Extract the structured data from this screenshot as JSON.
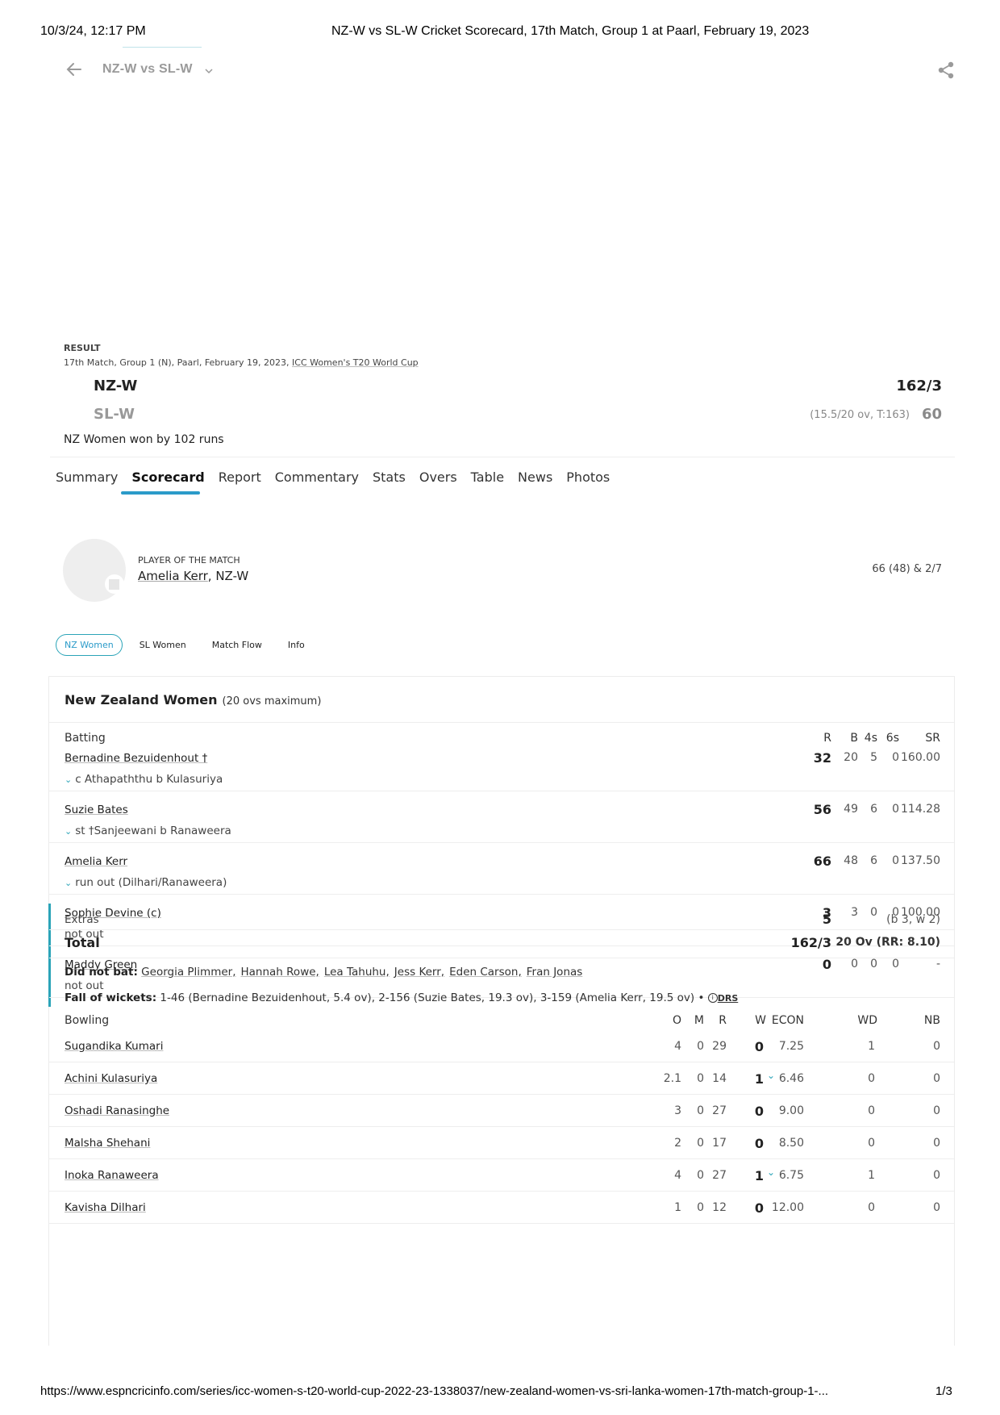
{
  "print_header": {
    "datetime": "10/3/24, 12:17 PM",
    "doc_title": "NZ-W vs SL-W Cricket Scorecard, 17th Match, Group 1 at Paarl, February 19, 2023"
  },
  "topbar": {
    "title": "NZ-W vs SL-W",
    "back_icon": "arrow-left-icon",
    "dropdown_icon": "chevron-down-icon",
    "share_icon": "share-icon"
  },
  "match": {
    "status_label": "RESULT",
    "info": "17th Match, Group 1 (N), Paarl, February 19, 2023, ",
    "series_link": "ICC Women's T20 World Cup",
    "team1": {
      "name": "NZ-W",
      "score": "162/3"
    },
    "team2": {
      "name": "SL-W",
      "meta": "(15.5/20 ov, T:163)",
      "score": "60"
    },
    "result": "NZ Women won by 102 runs"
  },
  "tabs": [
    {
      "label": "Summary",
      "active": false
    },
    {
      "label": "Scorecard",
      "active": true
    },
    {
      "label": "Report",
      "active": false
    },
    {
      "label": "Commentary",
      "active": false
    },
    {
      "label": "Stats",
      "active": false
    },
    {
      "label": "Overs",
      "active": false
    },
    {
      "label": "Table",
      "active": false
    },
    {
      "label": "News",
      "active": false
    },
    {
      "label": "Photos",
      "active": false
    }
  ],
  "potm": {
    "label": "PLAYER OF THE MATCH",
    "name": "Amelia Kerr",
    "team": ", NZ-W",
    "stats": "66 (48) & 2/7"
  },
  "innings_pills": [
    {
      "label": "NZ Women",
      "active": true
    },
    {
      "label": "SL Women",
      "active": false
    },
    {
      "label": "Match Flow",
      "active": false
    },
    {
      "label": "Info",
      "active": false
    }
  ],
  "innings": {
    "team": "New Zealand Women",
    "overs_note": "(20 ovs maximum)",
    "batting_header": {
      "label": "Batting",
      "r": "R",
      "b": "B",
      "fours": "4s",
      "sixes": "6s",
      "sr": "SR"
    },
    "batters": [
      {
        "name": "Bernadine Bezuidenhout †",
        "dismissal": "c Athapaththu b Kulasuriya",
        "expandable": true,
        "not_out": false,
        "r": "32",
        "b": "20",
        "fours": "5",
        "sixes": "0",
        "sr": "160.00"
      },
      {
        "name": "Suzie Bates",
        "dismissal": "st †Sanjeewani b Ranaweera",
        "expandable": true,
        "not_out": false,
        "r": "56",
        "b": "49",
        "fours": "6",
        "sixes": "0",
        "sr": "114.28"
      },
      {
        "name": "Amelia Kerr",
        "dismissal": "run out (Dilhari/Ranaweera)",
        "expandable": true,
        "not_out": false,
        "r": "66",
        "b": "48",
        "fours": "6",
        "sixes": "0",
        "sr": "137.50"
      },
      {
        "name": "Sophie Devine (c)",
        "dismissal": "not out",
        "expandable": false,
        "not_out": true,
        "r": "3",
        "b": "3",
        "fours": "0",
        "sixes": "0",
        "sr": "100.00"
      },
      {
        "name": "Maddy Green",
        "dismissal": "not out",
        "expandable": false,
        "not_out": true,
        "r": "0",
        "b": "0",
        "fours": "0",
        "sixes": "0",
        "sr": "-"
      }
    ],
    "extras": {
      "label": "Extras",
      "value": "5",
      "detail": "(b 3, w 2)"
    },
    "total": {
      "label": "Total",
      "value": "162/3",
      "detail": "20 Ov (RR: 8.10)"
    },
    "did_not_bat": {
      "label": "Did not bat:",
      "players": [
        "Georgia Plimmer,",
        "Hannah Rowe,",
        "Lea Tahuhu,",
        "Jess Kerr,",
        "Eden Carson,",
        "Fran Jonas"
      ]
    },
    "fall_of_wickets": {
      "label": "Fall of wickets:",
      "text": "1-46 (Bernadine Bezuidenhout, 5.4 ov), 2-156 (Suzie Bates, 19.3 ov), 3-159 (Amelia Kerr, 19.5 ov) •",
      "drs_label": "DRS"
    },
    "bowling_header": {
      "label": "Bowling",
      "o": "O",
      "m": "M",
      "r": "R",
      "w": "W",
      "econ": "ECON",
      "wd": "WD",
      "nb": "NB"
    },
    "bowlers": [
      {
        "name": "Sugandika Kumari",
        "o": "4",
        "m": "0",
        "r": "29",
        "w": "0",
        "expandable": false,
        "econ": "7.25",
        "wd": "1",
        "nb": "0"
      },
      {
        "name": "Achini Kulasuriya",
        "o": "2.1",
        "m": "0",
        "r": "14",
        "w": "1",
        "expandable": true,
        "econ": "6.46",
        "wd": "0",
        "nb": "0"
      },
      {
        "name": "Oshadi Ranasinghe",
        "o": "3",
        "m": "0",
        "r": "27",
        "w": "0",
        "expandable": false,
        "econ": "9.00",
        "wd": "0",
        "nb": "0"
      },
      {
        "name": "Malsha Shehani",
        "o": "2",
        "m": "0",
        "r": "17",
        "w": "0",
        "expandable": false,
        "econ": "8.50",
        "wd": "0",
        "nb": "0"
      },
      {
        "name": "Inoka Ranaweera",
        "o": "4",
        "m": "0",
        "r": "27",
        "w": "1",
        "expandable": true,
        "econ": "6.75",
        "wd": "1",
        "nb": "0"
      },
      {
        "name": "Kavisha Dilhari",
        "o": "1",
        "m": "0",
        "r": "12",
        "w": "0",
        "expandable": false,
        "econ": "12.00",
        "wd": "0",
        "nb": "0"
      }
    ]
  },
  "print_footer": {
    "url": "https://www.espncricinfo.com/series/icc-women-s-t20-world-cup-2022-23-1338037/new-zealand-women-vs-sri-lanka-women-17th-match-group-1-...",
    "page": "1/3"
  },
  "colors": {
    "accent": "#2b9bc9",
    "teal": "#2ba4b8"
  }
}
